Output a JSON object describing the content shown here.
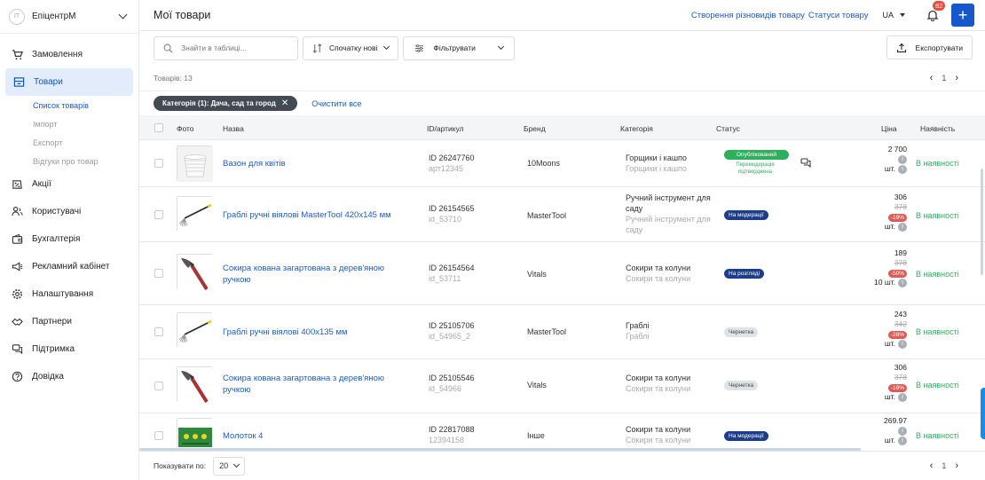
{
  "store": {
    "avatar": "ІТ",
    "name": "ЕпіцентрМ"
  },
  "nav": [
    {
      "icon": "cart-icon",
      "label": "Замовлення",
      "active": false
    },
    {
      "icon": "box-icon",
      "label": "Товари",
      "active": true
    },
    {
      "icon": "percent-icon",
      "label": "Акції",
      "active": false
    },
    {
      "icon": "users-icon",
      "label": "Користувачі",
      "active": false
    },
    {
      "icon": "wallet-icon",
      "label": "Бухгалтерія",
      "active": false
    },
    {
      "icon": "megaphone-icon",
      "label": "Рекламний кабінет",
      "active": false
    },
    {
      "icon": "gear-icon",
      "label": "Налаштування",
      "active": false
    },
    {
      "icon": "handshake-icon",
      "label": "Партнери",
      "active": false
    },
    {
      "icon": "chat-icon",
      "label": "Підтримка",
      "active": false
    },
    {
      "icon": "help-icon",
      "label": "Довідка",
      "active": false
    }
  ],
  "subnav": [
    {
      "label": "Список товарів",
      "active": true
    },
    {
      "label": "Імпорт",
      "active": false
    },
    {
      "label": "Експорт",
      "active": false
    },
    {
      "label": "Відгуки про товар",
      "active": false
    }
  ],
  "header": {
    "title": "Мої товари",
    "link1": "Створення різновидів товару",
    "link2": "Статуси товару",
    "lang": "UA",
    "notifications": "82"
  },
  "toolbar": {
    "search_placeholder": "Знайти в таблиці...",
    "sort_label": "Спочатку нові",
    "filter_label": "Фільтрувати",
    "export_label": "Експортувати"
  },
  "count": {
    "label": "Товарів: 13",
    "page": "1"
  },
  "filters": {
    "chip": "Категорія (1): Дача, сад та город",
    "clear": "Очистити все"
  },
  "table": {
    "headers": {
      "photo": "Фото",
      "name": "Назва",
      "id": "ID/артикул",
      "brand": "Бренд",
      "category": "Категорія",
      "status": "Статус",
      "price": "Ціна",
      "availability": "Наявність"
    },
    "rows": [
      {
        "photo": "vase",
        "name": "Вазон для квітів",
        "id": "ID 26247760",
        "sku": "арт12345",
        "brand": "10Moons",
        "cat": "Горщики і кашпо",
        "cat2": "Горщики і кашпо",
        "status": "Опублікований",
        "status_type": "pub",
        "status_note": "Перемодерація підтверджена",
        "price": "2 700",
        "old": "",
        "disc": "",
        "qty_unit": "шт.",
        "avail": "В наявності"
      },
      {
        "photo": "rake",
        "name": "Граблі ручні віялові MasterTool 420x145 мм",
        "id": "ID 26154565",
        "sku": "id_53710",
        "brand": "MasterTool",
        "cat": "Ручний інструмент для саду",
        "cat2": "Ручний інструмент для саду",
        "status": "На модерації",
        "status_type": "mod",
        "status_note": "",
        "price": "306",
        "old": "378",
        "disc": "-19%",
        "qty_unit": "шт.",
        "avail": "В наявності"
      },
      {
        "photo": "axe",
        "name": "Сокира кована загартована з дерев'яною ручкою",
        "id": "ID 26154564",
        "sku": "id_53711",
        "brand": "Vitals",
        "cat": "Сокири та колуни",
        "cat2": "Сокири та колуни",
        "status": "На розгляді",
        "status_type": "rev",
        "status_note": "",
        "price": "189",
        "old": "378",
        "disc": "-50%",
        "qty_unit": "10 шт.",
        "avail": "В наявності"
      },
      {
        "photo": "rake",
        "name": "Граблі ручні віялові 400x135 мм",
        "id": "ID 25105706",
        "sku": "id_54965_2",
        "brand": "MasterTool",
        "cat": "Граблі",
        "cat2": "Граблі",
        "status": "Чернетка",
        "status_type": "draft",
        "status_note": "",
        "price": "243",
        "old": "342",
        "disc": "-28%",
        "qty_unit": "шт.",
        "avail": "В наявності"
      },
      {
        "photo": "axe",
        "name": "Сокира кована загартована з дерев'яною ручкою",
        "id": "ID 25105546",
        "sku": "id_54966",
        "brand": "Vitals",
        "cat": "Сокири та колуни",
        "cat2": "Сокири та колуни",
        "status": "Чернетка",
        "status_type": "draft",
        "status_note": "",
        "price": "306",
        "old": "378",
        "disc": "-19%",
        "qty_unit": "шт.",
        "avail": "В наявності"
      },
      {
        "photo": "hammer",
        "name": "Молоток 4",
        "id": "ID 22817088",
        "sku": "12394158",
        "brand": "Інше",
        "cat": "Сокири та колуни",
        "cat2": "Сокири та колуни",
        "status": "На модерації",
        "status_type": "mod",
        "status_note": "",
        "price": "269.97",
        "old": "",
        "disc": "",
        "qty_unit": "шт.",
        "avail": "В наявності"
      }
    ]
  },
  "footer": {
    "per_page_label": "Показувати по:",
    "per_page": "20",
    "page": "1"
  }
}
